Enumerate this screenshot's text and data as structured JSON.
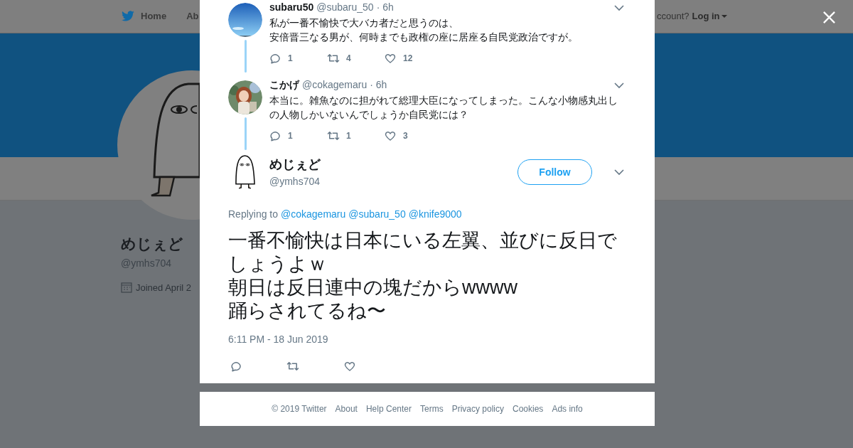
{
  "nav": {
    "items": [
      {
        "label": "Home",
        "kind": "logo"
      },
      {
        "label": "Ab",
        "kind": "plain"
      }
    ],
    "account_prompt": "ccount?",
    "login": "Log in"
  },
  "profile": {
    "name": "めじぇど",
    "handle": "@ymhs704",
    "joined": "Joined April 2"
  },
  "thread": [
    {
      "name": "subaru50",
      "handle": "@subaru_50",
      "time": "· 6h",
      "lines": [
        "私が一番不愉快で大バカ者だと思うのは、",
        "安倍晋三なる男が、何時までも政権の座に居座る自民党政治ですが。"
      ],
      "replies": "1",
      "retweets": "4",
      "likes": "12"
    },
    {
      "name": "こかげ",
      "handle": "@cokagemaru",
      "time": "· 6h",
      "lines": [
        "本当に。雑魚なのに担がれて総理大臣になってしまった。こんな小物感丸出しの人物しかいないんでしょうか自民党には？"
      ],
      "replies": "1",
      "retweets": "1",
      "likes": "3"
    }
  ],
  "tweet": {
    "name": "めじぇど",
    "handle": "@ymhs704",
    "follow": "Follow",
    "replying_label": "Replying to",
    "mentions": [
      "@cokagemaru",
      "@subaru_50",
      "@knife9000"
    ],
    "lines": [
      "一番不愉快は日本にいる左翼、並びに反日でしょうよｗ",
      "朝日は反日連中の塊だからwwww",
      "踊らされてるね〜"
    ],
    "timestamp": "6:11 PM - 18 Jun 2019"
  },
  "footer": [
    "© 2019 Twitter",
    "About",
    "Help Center",
    "Terms",
    "Privacy policy",
    "Cookies",
    "Ads info"
  ]
}
